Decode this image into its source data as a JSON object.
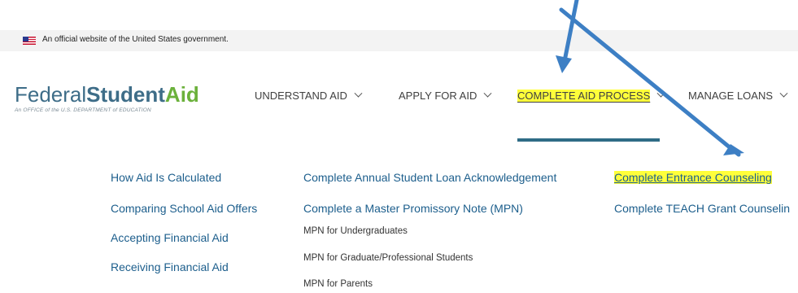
{
  "banner": {
    "text": "An official website of the United States government.",
    "flag_icon": "us-flag-icon"
  },
  "logo": {
    "word1": "Federal",
    "word2": "Student",
    "word3": "Aid",
    "subtitle": "An OFFICE of the U.S. DEPARTMENT of EDUCATION"
  },
  "nav": [
    {
      "label": "UNDERSTAND AID",
      "active": false
    },
    {
      "label": "APPLY FOR AID",
      "active": false
    },
    {
      "label": "COMPLETE AID PROCESS",
      "active": true
    },
    {
      "label": "MANAGE LOANS",
      "active": false
    }
  ],
  "menu": {
    "col1": [
      "How Aid Is Calculated",
      "Comparing School Aid Offers",
      "Accepting Financial Aid",
      "Receiving Financial Aid"
    ],
    "col2": [
      "Complete Annual Student Loan Acknowledgement",
      "Complete a Master Promissory Note (MPN)"
    ],
    "col2_sub": [
      "MPN for Undergraduates",
      "MPN for Graduate/Professional Students",
      "MPN for Parents"
    ],
    "col3": [
      "Complete Entrance Counseling",
      "Complete TEACH Grant Counselin"
    ]
  },
  "colors": {
    "brand_blue": "#3e6d88",
    "brand_green": "#6bb13b",
    "link_blue": "#1c5e8c",
    "highlight": "#ffff3a",
    "arrow": "#3d7fc4"
  }
}
